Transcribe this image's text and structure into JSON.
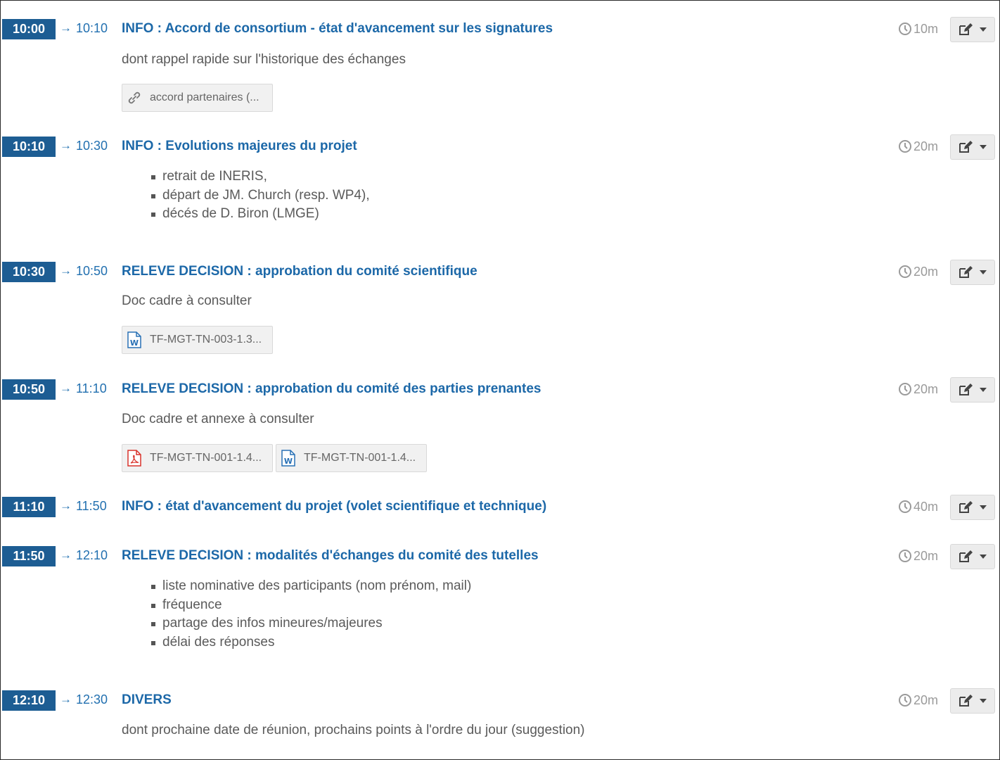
{
  "colors": {
    "accent": "#1d5d93",
    "title": "#1c68a8",
    "muted": "#9a9a9a",
    "pdf": "#d9322b",
    "word": "#2870b5"
  },
  "arrow": "→",
  "items": [
    {
      "start": "10:00",
      "end": "10:10",
      "title": "INFO : Accord de consortium - état d'avancement sur les signatures",
      "duration": "10m",
      "description": "dont rappel rapide sur l'historique des échanges",
      "attachments": [
        {
          "icon": "link-icon",
          "label": "accord partenaires (..."
        }
      ]
    },
    {
      "start": "10:10",
      "end": "10:30",
      "title": "INFO : Evolutions majeures du projet",
      "duration": "20m",
      "bullets": [
        "retrait de INERIS,",
        "départ de JM. Church (resp. WP4),",
        "décés de D. Biron (LMGE)"
      ]
    },
    {
      "start": "10:30",
      "end": "10:50",
      "title": "RELEVE DECISION : approbation du comité scientifique",
      "duration": "20m",
      "description": "Doc cadre à consulter",
      "attachments": [
        {
          "icon": "word-file-icon",
          "label": "TF-MGT-TN-003-1.3..."
        }
      ]
    },
    {
      "start": "10:50",
      "end": "11:10",
      "title": "RELEVE DECISION : approbation du comité des parties prenantes",
      "duration": "20m",
      "description": "Doc cadre et annexe à consulter",
      "attachments": [
        {
          "icon": "pdf-file-icon",
          "label": "TF-MGT-TN-001-1.4..."
        },
        {
          "icon": "word-file-icon",
          "label": "TF-MGT-TN-001-1.4..."
        }
      ]
    },
    {
      "start": "11:10",
      "end": "11:50",
      "title": "INFO : état d'avancement du projet (volet scientifique et technique)",
      "duration": "40m"
    },
    {
      "start": "11:50",
      "end": "12:10",
      "title": "RELEVE DECISION : modalités d'échanges du comité des tutelles",
      "duration": "20m",
      "bullets": [
        "liste nominative des participants (nom prénom, mail)",
        "fréquence",
        "partage des infos mineures/majeures",
        "délai des réponses"
      ]
    },
    {
      "start": "12:10",
      "end": "12:30",
      "title": "DIVERS",
      "duration": "20m",
      "description": "dont prochaine date de réunion, prochains points à l'ordre du jour (suggestion)"
    }
  ]
}
